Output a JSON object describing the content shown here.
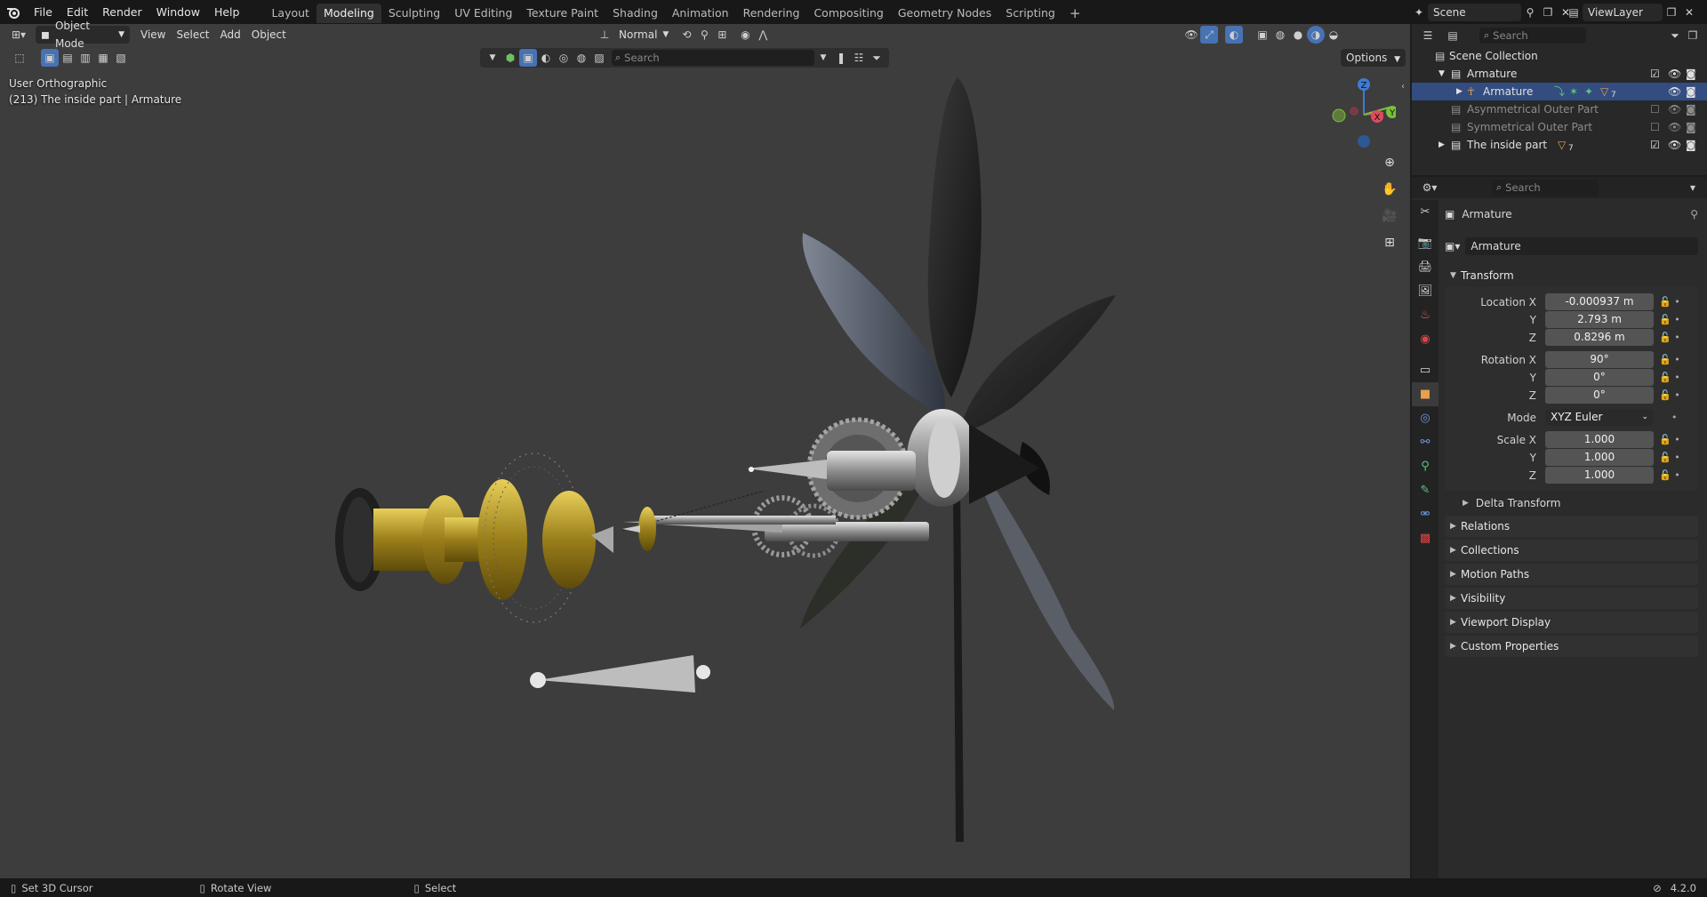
{
  "topbar": {
    "menus": [
      "File",
      "Edit",
      "Render",
      "Window",
      "Help"
    ],
    "workspaces": [
      "Layout",
      "Modeling",
      "Sculpting",
      "UV Editing",
      "Texture Paint",
      "Shading",
      "Animation",
      "Rendering",
      "Compositing",
      "Geometry Nodes",
      "Scripting"
    ],
    "active_workspace": "Modeling",
    "add_tab_label": "+",
    "scene_name": "Scene",
    "view_layer_name": "ViewLayer"
  },
  "viewport_header": {
    "mode": "Object Mode",
    "menus": [
      "View",
      "Select",
      "Add",
      "Object"
    ],
    "orientation": "Normal",
    "search_placeholder": "Search",
    "options_label": "Options"
  },
  "viewport_overlay": {
    "view_name": "User Orthographic",
    "object_info": "(213) The inside part | Armature",
    "gizmo_axes": {
      "z": "Z",
      "y": "Y",
      "x": "X"
    }
  },
  "outliner": {
    "search_placeholder": "Search",
    "rows": [
      {
        "label": "Scene Collection"
      },
      {
        "label": "Armature"
      },
      {
        "label": "Armature"
      },
      {
        "label": "Asymmetrical Outer Part"
      },
      {
        "label": "Symmetrical Outer Part"
      },
      {
        "label": "The inside part"
      }
    ],
    "modifier_count": "7"
  },
  "properties": {
    "search_placeholder": "Search",
    "object_name": "Armature",
    "data_name": "Armature",
    "transform_title": "Transform",
    "labels": {
      "location_x": "Location X",
      "y": "Y",
      "z": "Z",
      "rotation_x": "Rotation X",
      "mode": "Mode",
      "scale_x": "Scale X"
    },
    "location": [
      "-0.000937 m",
      "2.793 m",
      "0.8296 m"
    ],
    "rotation": [
      "90°",
      "0°",
      "0°"
    ],
    "rotation_mode": "XYZ Euler",
    "scale": [
      "1.000",
      "1.000",
      "1.000"
    ],
    "delta_transform": "Delta Transform",
    "panels": [
      "Relations",
      "Collections",
      "Motion Paths",
      "Visibility",
      "Viewport Display",
      "Custom Properties"
    ]
  },
  "statusbar": {
    "hints": [
      "Set 3D Cursor",
      "Rotate View",
      "Select"
    ],
    "version": "4.2.0"
  }
}
